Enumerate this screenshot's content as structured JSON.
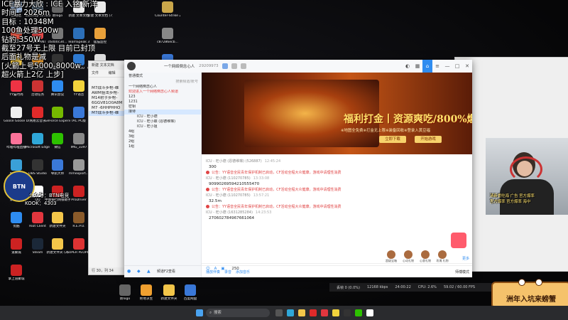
{
  "overlay": {
    "lines": [
      "ICE暴力大欣 : ICE 入铭 新洋",
      "时间 : 2026m",
      "目标 : 10348M",
      "100鱼处理500w",
      "钻豹-350W",
      "截至27号无上限 目前已封顶",
      "后面礼物是减",
      "[火箭上号5000-8000w",
      "超火箭上2亿 上步]"
    ]
  },
  "btn_logo": {
    "mark": "BTN",
    "line1": "公众号：BTN电竞",
    "line2": "KOOK：4303"
  },
  "desktop_icons": [
    {
      "label": "回收站",
      "color": "#9fb6d6"
    },
    {
      "label": "Tabletop Simulator",
      "color": "#5a6b7a"
    },
    {
      "label": "新logo",
      "color": "#666"
    },
    {
      "label": "新建 文本文档",
      "color": "#eaeaea"
    },
    {
      "label": "新建 文本文档 (7)",
      "color": "#eaeaea"
    },
    {
      "label": "Counter-Strike 2",
      "color": "#c9a64a"
    },
    {
      "label": "LZKH2MLP",
      "color": "#d54"
    },
    {
      "label": "VALORANT",
      "color": "#e24a4a"
    },
    {
      "label": "c6d00c34...",
      "color": "#777"
    },
    {
      "label": "TeamSpeak 3",
      "color": "#2c6fb8"
    },
    {
      "label": "猛猫监控",
      "color": "#e8a03a"
    },
    {
      "label": "c87286ecb...",
      "color": "#888"
    },
    {
      "label": "UU加速器",
      "color": "#3a78d8"
    },
    {
      "label": "网易UU",
      "color": "#2e7ad1"
    },
    {
      "label": "Woolily",
      "color": "#e8c24a"
    },
    {
      "label": "绝地求生",
      "color": "#f0a030"
    },
    {
      "label": "三角洲行动",
      "color": "#333"
    },
    {
      "label": "Goose Goose Duck",
      "color": "#ddd"
    },
    {
      "label": "YY语音",
      "color": "#f2d33c"
    },
    {
      "label": "YY猫时尚",
      "color": "#e34"
    },
    {
      "label": "活动任务",
      "color": "#c33"
    },
    {
      "label": "腾讯会议",
      "color": "#2e8cf0"
    },
    {
      "label": "Goose Goose Duck",
      "color": "#eee"
    },
    {
      "label": "网易云音乐",
      "color": "#e02a2a"
    },
    {
      "label": "GeForce Experience",
      "color": "#76b900"
    },
    {
      "label": "IAC PC版",
      "color": "#3a78d8"
    },
    {
      "label": "哔哩哔哩直播",
      "color": "#fb7299"
    },
    {
      "label": "Microsoft Edge",
      "color": "#2fa7d8"
    },
    {
      "label": "微信",
      "color": "#2dc100"
    },
    {
      "label": "IMG_3397",
      "color": "#888"
    },
    {
      "label": "城堡游戏",
      "color": "#3aa0d8"
    },
    {
      "label": "穿越火线",
      "color": "#c22"
    },
    {
      "label": "OBS Studio",
      "color": "#333"
    },
    {
      "label": "导航大师",
      "color": "#3a78d8"
    },
    {
      "label": "mmexport...",
      "color": "#999"
    },
    {
      "label": "优酷",
      "color": "#2e8cf0"
    },
    {
      "label": "QQ",
      "color": "#fff"
    },
    {
      "label": "中国银行网银助手",
      "color": "#c22"
    },
    {
      "label": "ProDriver",
      "color": "#c22"
    },
    {
      "label": "道聚城",
      "color": "#c22"
    },
    {
      "label": "Riot Client",
      "color": "#e2363e"
    },
    {
      "label": "新建文件夹",
      "color": "#f3c64a"
    },
    {
      "label": "R.E.P.O.",
      "color": "#8a5a2a"
    },
    {
      "label": "掌上道聚城",
      "color": "#c22"
    },
    {
      "label": "Steam",
      "color": "#1b2838"
    },
    {
      "label": "新建文件夹 (2)",
      "color": "#f3c64a"
    },
    {
      "label": "SUPER PEOPLE",
      "color": "#d33"
    },
    {
      "label": "新logo",
      "color": "#666"
    },
    {
      "label": "绝地求生",
      "color": "#f0a030"
    },
    {
      "label": "新建文件夹",
      "color": "#f3c64a"
    },
    {
      "label": "百度网盘",
      "color": "#3a78d8"
    }
  ],
  "notepad": {
    "title": "新建 文本文档",
    "menu_file": "文件",
    "menu_edit": "编辑",
    "lines": [
      "M7战斗步枪-维",
      "AWM狙击步枪-",
      "M14射手步枪-",
      "6GGV81O0A8M",
      "M7 -6HHPHHO",
      "M7战斗步枪-维"
    ],
    "status": "行 30，列 34"
  },
  "yy": {
    "channel_title": "一个网络倒念心人",
    "channel_id": "29209973",
    "sidebar": {
      "mode": "普通模式",
      "search": "搜索频道/账号",
      "rows": [
        {
          "text": "一个网络倒念心人",
          "cls": ""
        },
        {
          "text": "欢迎进入一个网络倒念心人频道",
          "cls": "red"
        },
        {
          "text": "123",
          "cls": ""
        },
        {
          "text": "1231",
          "cls": ""
        },
        {
          "text": "密钥",
          "cls": ""
        },
        {
          "text": "接待",
          "cls": "sel"
        },
        {
          "text": "ICU - 旺小德",
          "cls": ""
        },
        {
          "text": "ICU - 旺小蝶 (恩德维琳)",
          "cls": ""
        },
        {
          "text": "ICU - 旺小姐",
          "cls": ""
        },
        {
          "text": "4组",
          "cls": ""
        },
        {
          "text": "3组",
          "cls": ""
        },
        {
          "text": "2组",
          "cls": ""
        },
        {
          "text": "1组",
          "cls": ""
        }
      ],
      "bottom_label": "频道F2查看"
    },
    "banner": {
      "headline": "福利打金丨资源爽吃/800%爆率",
      "sub": "※地图全免费※打金无上限※装备回收※登录入黄豆福",
      "btn_download": "立即下载",
      "btn_play": "开始游戏"
    },
    "chat": [
      {
        "type": "user",
        "name": "ICU - 旺小德 (恩德维琳) (526887)",
        "time": "12:45:24",
        "text": "300"
      },
      {
        "type": "sys",
        "text": "公告：YY语音全民青年保护机制已启动，CF活动全程大众健康，游戏中请理性消费"
      },
      {
        "type": "user",
        "name": "ICU - 旺小德 (110270785)",
        "time": "13:33:08",
        "text": "90990269594210555470"
      },
      {
        "type": "sys",
        "text": "公告：YY语音全民青年保护机制已启动，CF活动全程大众健康，游戏中请理性消费"
      },
      {
        "type": "user",
        "name": "ICU - 旺小德 (110270785)",
        "time": "13:57:21",
        "text": "32.5m"
      },
      {
        "type": "sys",
        "text": "公告：YY语音全民青年保护机制已启动，CF活动全程大众健康，游戏中请理性消费"
      },
      {
        "type": "user",
        "name": "ICU - 旺小德 (1631285284)",
        "time": "14:23:53",
        "text": "270602784967661064"
      }
    ],
    "gift_avatars": [
      "超级宝箱",
      "心动礼物",
      "心意礼物",
      "玫瑰 礼物"
    ],
    "more_label": "更多",
    "input_value": "250",
    "bottom": {
      "mic": "按住F2说话",
      "chat": "播放伴奏",
      "scene": "录音",
      "effects": "添加音乐",
      "mode": "师傅模式"
    }
  },
  "perf": {
    "fps_drop": "丢帧 0 (0.0%)",
    "bitrate": "12168 kbps",
    "time": "24:00:22",
    "cpu": "CPU: 2.6%",
    "fps": "59.02 / 60.00 FPS"
  },
  "cam": {
    "line1": "清新爱吃海 广告 官方爆率",
    "line2": "官方爆率 官方爆率 海中"
  },
  "crab_text": "洲年入坑来螃蟹",
  "taskbar": {
    "search": "搜索"
  }
}
